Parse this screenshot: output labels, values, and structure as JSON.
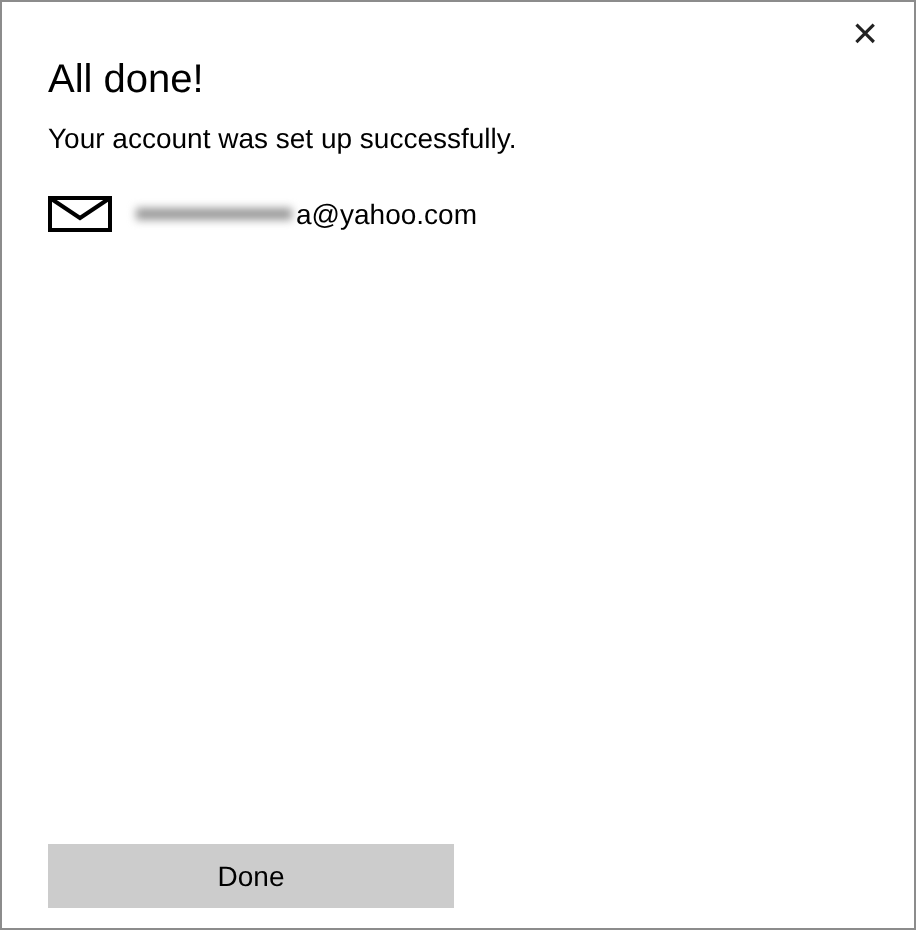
{
  "window": {
    "close": "×"
  },
  "title": "All done!",
  "message": "Your account was set up successfully.",
  "account": {
    "email": "a@yahoo.com",
    "redacted": true
  },
  "buttons": [
    {
      "label": "Done"
    }
  ]
}
